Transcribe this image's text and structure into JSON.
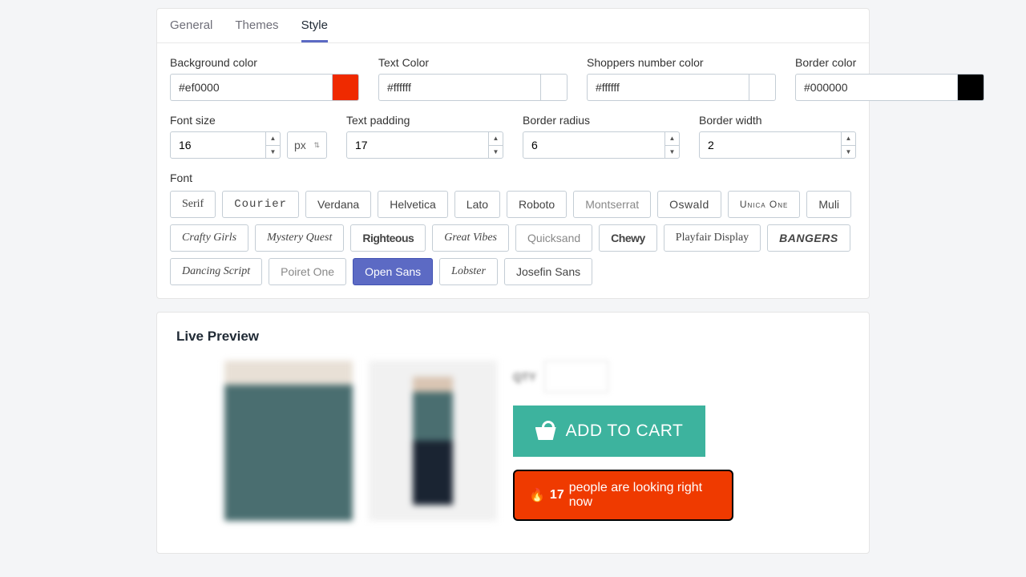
{
  "tabs": {
    "general": "General",
    "themes": "Themes",
    "style": "Style"
  },
  "labels": {
    "bg": "Background color",
    "text": "Text Color",
    "shoppers": "Shoppers number color",
    "border": "Border color",
    "fontsize": "Font size",
    "padding": "Text padding",
    "radius": "Border radius",
    "bwidth": "Border width",
    "font": "Font",
    "unit": "px"
  },
  "values": {
    "bg": "#ef0000",
    "text": "#ffffff",
    "shoppers": "#ffffff",
    "border": "#000000",
    "fontsize": "16",
    "padding": "17",
    "radius": "6",
    "bwidth": "2"
  },
  "swatches": {
    "bg": "#ef2a00",
    "text": "#ffffff",
    "shoppers": "#ffffff",
    "border": "#000000"
  },
  "fonts": [
    "Serif",
    "Courier",
    "Verdana",
    "Helvetica",
    "Lato",
    "Roboto",
    "Montserrat",
    "Oswald",
    "Unica One",
    "Muli",
    "Crafty Girls",
    "Mystery Quest",
    "Righteous",
    "Great Vibes",
    "Quicksand",
    "Chewy",
    "Playfair Display",
    "BANGERS",
    "Dancing Script",
    "Poiret One",
    "Open Sans",
    "Lobster",
    "Josefin Sans"
  ],
  "selected_font": "Open Sans",
  "preview": {
    "title": "Live Preview",
    "add_to_cart": "ADD TO CART",
    "notice_prefix": "🔥",
    "notice_count": "17",
    "notice_suffix": "people are looking right now"
  }
}
